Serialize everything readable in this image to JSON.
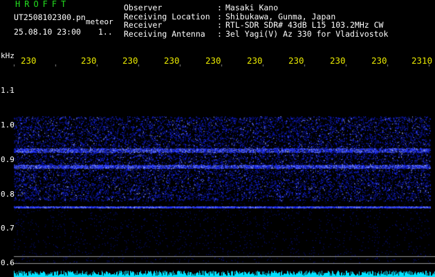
{
  "header": {
    "title": "HROFFT",
    "filename": "UT2508102300.pn",
    "tag": "meteor",
    "datetime": "25.08.10 23:00",
    "count": "1..",
    "labels": "Observer\nReceiving Location\nReceiver\nReceiving Antenna",
    "colons": ":\n:\n:\n:",
    "values": "Masaki Kano\nShibukawa, Gunma, Japan\nRTL-SDR SDR# 43dB L15 103.2MHz CW\n3el Yagi(V) Az 330 for Vladivostok"
  },
  "axis": {
    "y_unit": "kHz",
    "x_ticks": [
      "230",
      "230",
      "230",
      "230",
      "230",
      "230",
      "230",
      "230",
      "230",
      "2310"
    ],
    "y_ticks": [
      "1.1",
      "1.0",
      "0.9",
      "0.8",
      "0.7",
      "0.6"
    ]
  },
  "colors": {
    "background": "#000000",
    "signal": "#1b2cff",
    "bright_line": "#9fb0ff",
    "baseline": "#00e0ff",
    "title": "#23e01f",
    "tick_x": "#e8e800"
  }
}
